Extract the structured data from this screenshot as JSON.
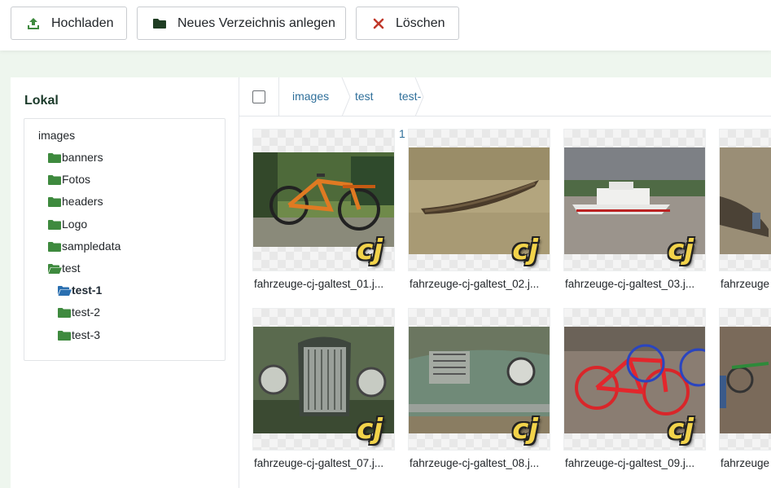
{
  "toolbar": {
    "upload_label": "Hochladen",
    "new_folder_label": "Neues Verzeichnis anlegen",
    "delete_label": "Löschen",
    "upload_icon": "upload-icon",
    "folder_icon": "folder-icon",
    "delete_icon": "x-icon"
  },
  "sidebar": {
    "title": "Lokal",
    "root": "images",
    "items": [
      {
        "label": "banners",
        "level": 1,
        "open": false,
        "active": false
      },
      {
        "label": "Fotos",
        "level": 1,
        "open": false,
        "active": false
      },
      {
        "label": "headers",
        "level": 1,
        "open": false,
        "active": false
      },
      {
        "label": "Logo",
        "level": 1,
        "open": false,
        "active": false
      },
      {
        "label": "sampledata",
        "level": 1,
        "open": false,
        "active": false
      },
      {
        "label": "test",
        "level": 1,
        "open": true,
        "active": false
      },
      {
        "label": "test-1",
        "level": 2,
        "open": true,
        "active": true
      },
      {
        "label": "test-2",
        "level": 2,
        "open": false,
        "active": false
      },
      {
        "label": "test-3",
        "level": 2,
        "open": false,
        "active": false
      }
    ]
  },
  "breadcrumb": [
    "images",
    "test",
    "test-1"
  ],
  "files": [
    {
      "name": "fahrzeuge-cj-galtest_01.j...",
      "watermark": "cj"
    },
    {
      "name": "fahrzeuge-cj-galtest_02.j...",
      "watermark": "cj"
    },
    {
      "name": "fahrzeuge-cj-galtest_03.j...",
      "watermark": "cj"
    },
    {
      "name": "fahrzeuge",
      "watermark": ""
    },
    {
      "name": "fahrzeuge-cj-galtest_07.j...",
      "watermark": "cj"
    },
    {
      "name": "fahrzeuge-cj-galtest_08.j...",
      "watermark": "cj"
    },
    {
      "name": "fahrzeuge-cj-galtest_09.j...",
      "watermark": "cj"
    },
    {
      "name": "fahrzeuge",
      "watermark": ""
    }
  ],
  "colors": {
    "folder_green": "#3e8a3e",
    "folder_active_blue": "#2a6fb0",
    "link_blue": "#2f6f9a",
    "delete_red": "#c0392b"
  }
}
